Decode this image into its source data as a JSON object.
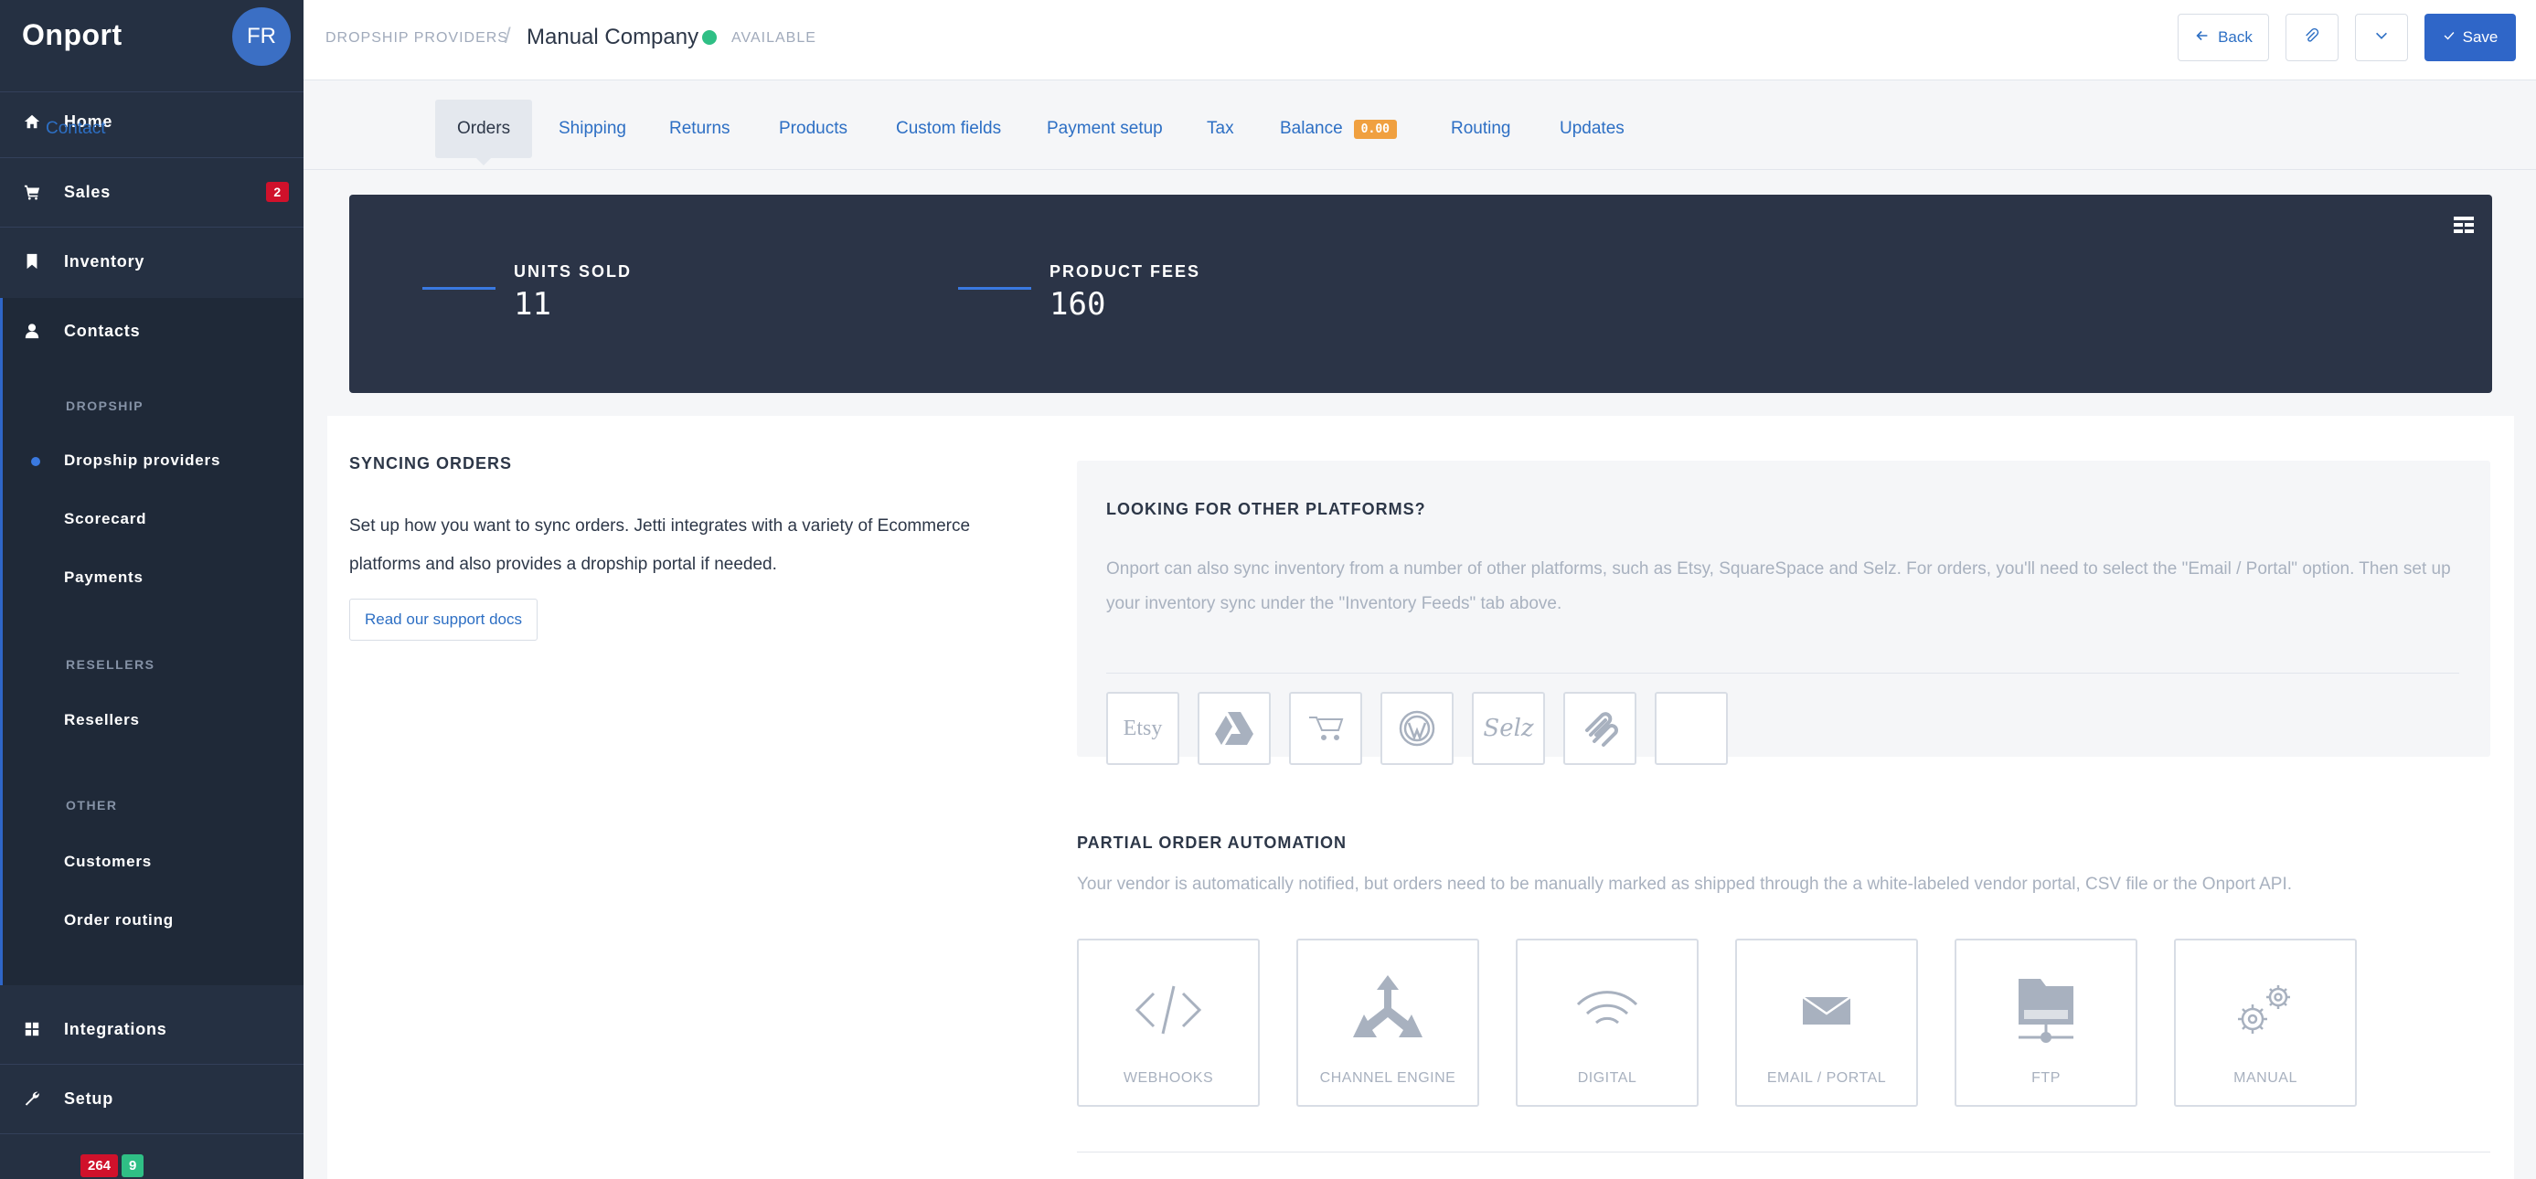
{
  "app": {
    "brand": "Onport",
    "avatar_initials": "FR"
  },
  "sidebar": {
    "home": "Home",
    "sales": "Sales",
    "sales_badge": "2",
    "inventory": "Inventory",
    "contacts": "Contacts",
    "dropship_header": "DROPSHIP",
    "dropship_providers": "Dropship providers",
    "scorecard": "Scorecard",
    "payments": "Payments",
    "resellers_header": "RESELLERS",
    "resellers": "Resellers",
    "other_header": "OTHER",
    "customers": "Customers",
    "order_routing": "Order routing",
    "integrations": "Integrations",
    "setup": "Setup",
    "bottom_badge_red": "264",
    "bottom_badge_green": "9"
  },
  "header": {
    "breadcrumb_parent": "DROPSHIP PROVIDERS",
    "breadcrumb_separator": "/",
    "title": "Manual Company",
    "status": "AVAILABLE",
    "back_label": "Back",
    "save_label": "Save"
  },
  "tabs": {
    "contact": "Contact",
    "orders": "Orders",
    "shipping": "Shipping",
    "returns": "Returns",
    "products": "Products",
    "custom_fields": "Custom fields",
    "payment_setup": "Payment setup",
    "tax": "Tax",
    "balance": "Balance",
    "balance_badge": "0.00",
    "routing": "Routing",
    "updates": "Updates"
  },
  "stats": {
    "units_sold_label": "UNITS SOLD",
    "units_sold_value": "11",
    "product_fees_label": "PRODUCT FEES",
    "product_fees_value": "160"
  },
  "syncing": {
    "title": "SYNCING ORDERS",
    "description": "Set up how you want to sync orders. Jetti integrates with a variety of Ecommerce platforms and also provides a dropship portal if needed.",
    "docs_button": "Read our support docs"
  },
  "platforms": {
    "title": "LOOKING FOR OTHER PLATFORMS?",
    "description": "Onport can also sync inventory from a number of other platforms, such as Etsy, SquareSpace and Selz. For orders, you'll need to select the \"Email / Portal\" option. Then set up your inventory sync under the \"Inventory Feeds\" tab above.",
    "etsy_label": "Etsy",
    "selz_label": "Selz"
  },
  "automation": {
    "title": "PARTIAL ORDER AUTOMATION",
    "description": "Your vendor is automatically notified, but orders need to be manually marked as shipped through the a white-labeled vendor portal, CSV file or the Onport API.",
    "tiles": [
      "WEBHOOKS",
      "CHANNEL ENGINE",
      "DIGITAL",
      "EMAIL / PORTAL",
      "FTP",
      "MANUAL"
    ]
  },
  "colors": {
    "sidebar_bg": "#253042",
    "accent": "#2f66c8",
    "stats_bg": "#2b3447",
    "status_green": "#2fbf85",
    "badge_red": "#d0112b",
    "balance_orange": "#f0a040"
  }
}
